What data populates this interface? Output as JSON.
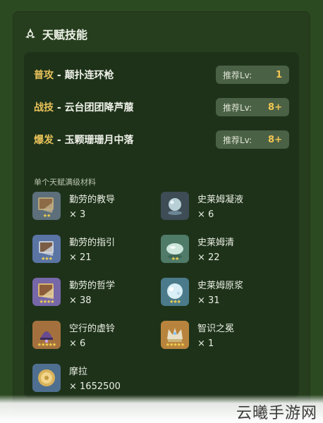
{
  "panel": {
    "title": "天赋技能",
    "title_icon": "talent-icon"
  },
  "talents": [
    {
      "type": "普攻",
      "separator": " - ",
      "name": "颠扑连环枪",
      "badge_label": "推荐Lv:",
      "badge_value": "1"
    },
    {
      "type": "战技",
      "separator": " - ",
      "name": "云台团团降芦菔",
      "badge_label": "推荐Lv:",
      "badge_value": "8+"
    },
    {
      "type": "爆发",
      "separator": " - ",
      "name": "玉颗珊珊月中落",
      "badge_label": "推荐Lv:",
      "badge_value": "8+"
    }
  ],
  "materials_section": {
    "title": "单个天赋满级材料",
    "items": [
      {
        "name": "勤劳的教导",
        "count": "× 3",
        "icon": "book-icon",
        "stars": "★★"
      },
      {
        "name": "史莱姆凝液",
        "count": "× 6",
        "icon": "slime-icon",
        "stars": ""
      },
      {
        "name": "勤劳的指引",
        "count": "× 21",
        "icon": "book-icon",
        "stars": "★★★"
      },
      {
        "name": "史莱姆清",
        "count": "× 22",
        "icon": "slime-icon",
        "stars": "★★"
      },
      {
        "name": "勤劳的哲学",
        "count": "× 38",
        "icon": "book-icon",
        "stars": "★★★★"
      },
      {
        "name": "史莱姆原浆",
        "count": "× 31",
        "icon": "slime-icon",
        "stars": "★★★"
      },
      {
        "name": "空行的虚铃",
        "count": "× 6",
        "icon": "bell-icon",
        "stars": "★★★★★"
      },
      {
        "name": "智识之冕",
        "count": "× 1",
        "icon": "crown-icon",
        "stars": "★★★★★"
      },
      {
        "name": "摩拉",
        "count": "× 1652500",
        "icon": "mora-icon",
        "stars": ""
      }
    ]
  },
  "watermark": {
    "text": "云曦手游网"
  },
  "colors": {
    "background": "#2c4a22",
    "panel": "#263e1e",
    "inner": "#1e321a",
    "accent_gold": "#e8c25a",
    "badge_bg": "#4b6146"
  }
}
